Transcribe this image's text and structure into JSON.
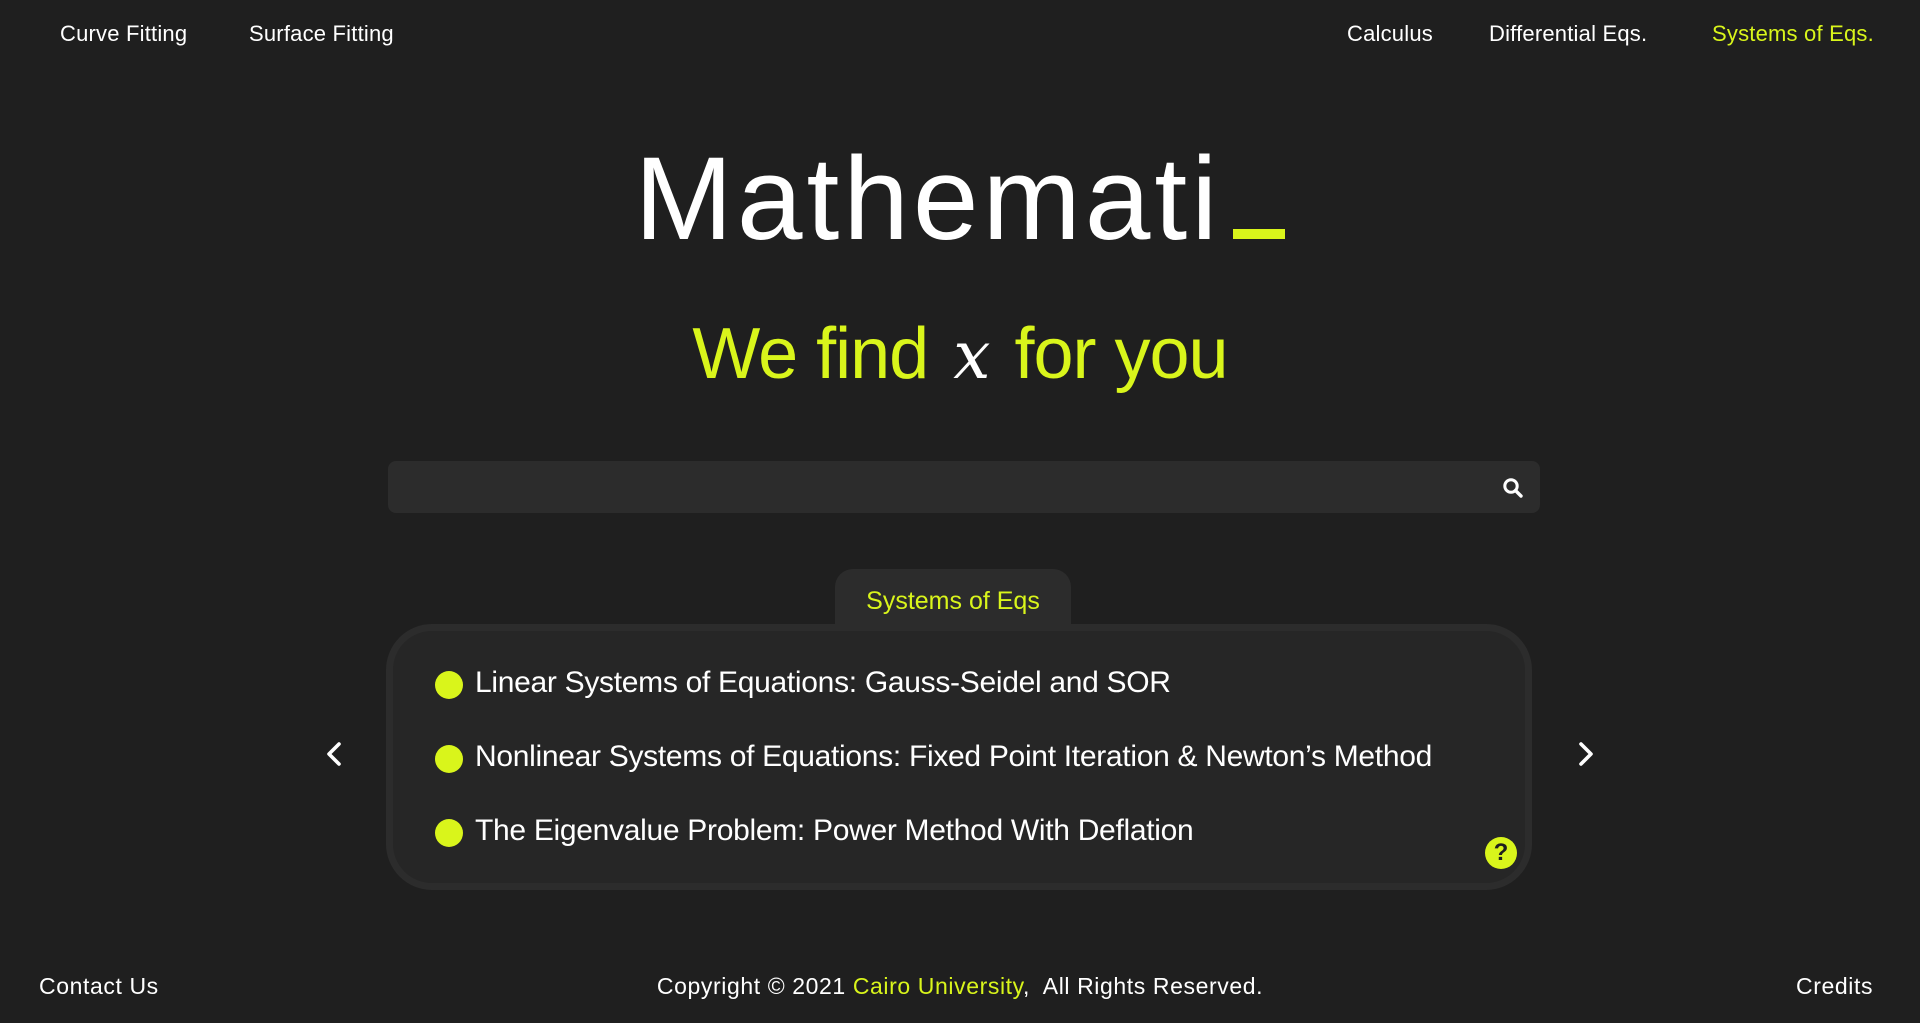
{
  "nav": {
    "left": [
      "Curve Fitting",
      "Surface Fitting"
    ],
    "right": [
      "Calculus",
      "Differential Eqs.",
      "Systems of Eqs."
    ],
    "active": "Systems of Eqs."
  },
  "hero": {
    "logo": "Mathemati",
    "tagline_before": "We find",
    "tagline_var": "x",
    "tagline_after": "for you"
  },
  "search": {
    "placeholder": "",
    "value": "",
    "icon": "search-icon"
  },
  "topic_card": {
    "tab_label": "Systems of Eqs",
    "items": [
      "Linear Systems of Equations: Gauss-Seidel and SOR",
      "Nonlinear Systems of Equations: Fixed Point Iteration & Newton’s Method",
      "The Eigenvalue Problem: Power Method With Deflation"
    ],
    "help_label": "?"
  },
  "footer": {
    "contact": "Contact Us",
    "copyright_prefix": "Copyright © 2021",
    "university": "Cairo University",
    "copyright_suffix": ",  All Rights Reserved.",
    "credits": "Credits"
  },
  "colors": {
    "background": "#1f1f1f",
    "accent": "#d9f51b",
    "surface": "#2c2c2c"
  }
}
